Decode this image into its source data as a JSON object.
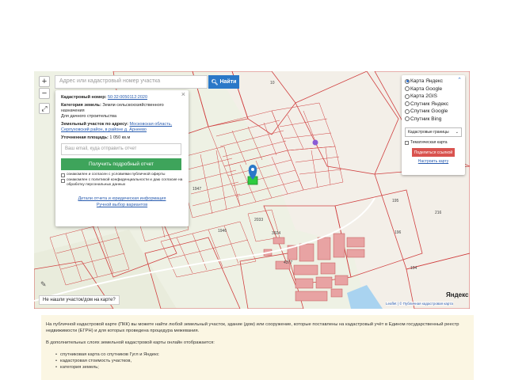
{
  "search": {
    "placeholder": "Адрес или кадастровый номер участка",
    "button_label": "Найти"
  },
  "controls": {
    "zoom_in": "+",
    "zoom_out": "−"
  },
  "info_card": {
    "cadastral_number_label": "Кадастровый номер:",
    "cadastral_number_value": "50:32:0050112:2020",
    "category_label": "Категория земель:",
    "category_value": "Земли сельскохозяйственного назначения",
    "usage": "Для дачного строительства",
    "address_label": "Земельный участок по адресу:",
    "address_value": "Московская область, Серпуховский район, в районе д. Арнеево",
    "area_label": "Уточненная площадь:",
    "area_value": "1 050 кв.м",
    "email_placeholder": "Ваш email, куда отправить отчет",
    "report_button": "Получить подробный отчет",
    "offer_text": "ознакомлен и согласен с условиями публичной оферты",
    "privacy_text": "ознакомлен с политикой конфиденциальности и даю согласие на обработку персональных данных",
    "details_link": "Детали отчета и юридическая информация",
    "manual_link": "Ручной выбор вариантов"
  },
  "layers": {
    "options": [
      {
        "label": "Карта Яндекс",
        "selected": true
      },
      {
        "label": "Карта Google",
        "selected": false
      },
      {
        "label": "Карта 2GIS",
        "selected": false
      },
      {
        "label": "Спутник Яндекс",
        "selected": false
      },
      {
        "label": "Спутник Google",
        "selected": false
      },
      {
        "label": "Спутник Bing",
        "selected": false
      }
    ],
    "bounds_select": "Кадастровые границы",
    "thematic_label": "Тематическая карта",
    "share_button": "Поделиться ссылкой",
    "setup_link": "Настроить карту"
  },
  "map": {
    "not_found": "Не нашли участок/дом на карте?",
    "brand": "Яндекс",
    "attribution": "Leaflet | © Публичная кадастровая карта",
    "plot_labels": [
      "10",
      "195",
      "196",
      "216",
      "194",
      "3924",
      "4377",
      "1947",
      "2033",
      "1946"
    ]
  },
  "description": {
    "para1": "На публичной кадастровой карте (ПКК) вы можете найти любой земельный участок, здание (дом) или сооружение, которые поставлены на кадастровый учёт в Едином государственный реестр недвижимости (ЕГРН) и для которых проведена процедура межевания.",
    "para2": "В дополнительных слоях земельной кадастровой карты онлайн отображается:",
    "items": [
      "спутниковая карта со спутников Гугл и Яндекс",
      "кадастровая стоимость участков,",
      "категория земель;"
    ]
  },
  "colors": {
    "search_button": "#2a78c8",
    "report_button": "#3ea45b",
    "share_button": "#d9534f",
    "parcel_border": "#d04040",
    "building_fill": "#e8a3a3",
    "selected_plot": "#2ecc40"
  }
}
